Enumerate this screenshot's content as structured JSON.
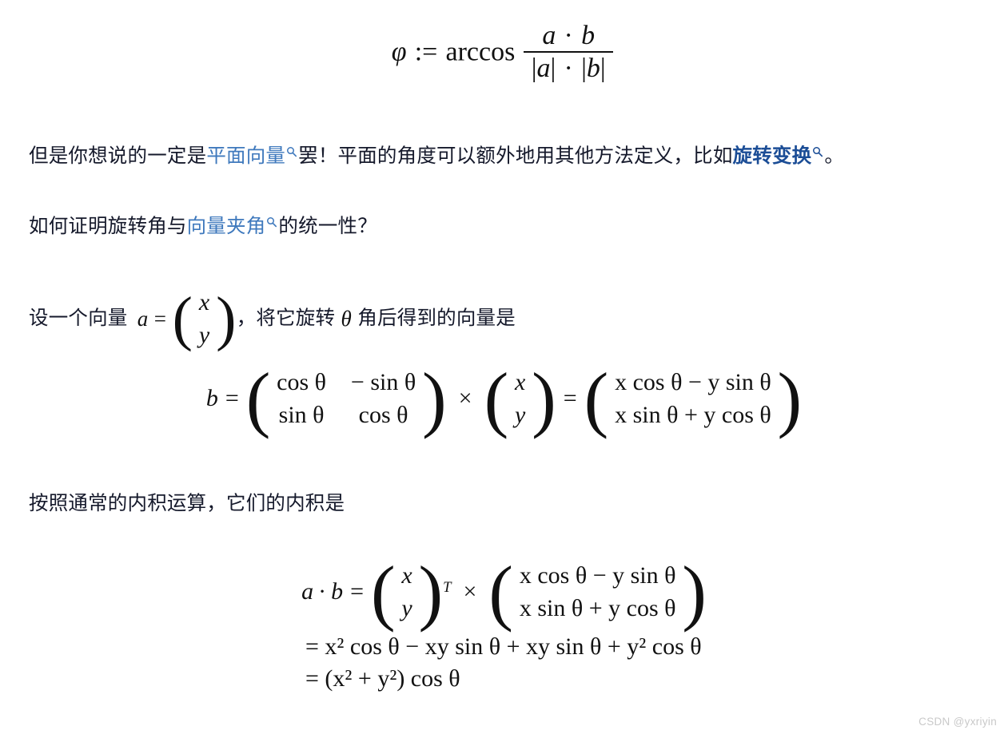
{
  "document": {
    "background": "#ffffff",
    "text_color": "#15192b",
    "math_color": "#111111",
    "link_color": "#3f79bd",
    "link_strong_color": "#1b4d96"
  },
  "formula_1": {
    "name": "angle-definition-formula",
    "phi": "φ",
    "assign": ":=",
    "arccos": "arccos",
    "numerator": {
      "a": "a",
      "dot": "·",
      "b": "b"
    },
    "denominator": {
      "abs_a_open": "|",
      "a": "a",
      "abs_a_close": "|",
      "dot": "·",
      "abs_b_open": "|",
      "b": "b",
      "abs_b_close": "|"
    }
  },
  "paragraph_1": {
    "part_1": "但是你想说的一定是",
    "link_1": "平面向量",
    "part_2": "罢！平面的角度可以额外地用其他方法定义，比如",
    "link_2": "旋转变换",
    "part_3": "。",
    "icon_1": "search-icon",
    "icon_2": "search-icon"
  },
  "paragraph_2": {
    "part_1": "如何证明旋转角与",
    "link_1": "向量夹角",
    "part_2": "的统一性？",
    "icon_1": "search-icon"
  },
  "paragraph_3": {
    "part_1": "设一个向量",
    "math_a": "a",
    "math_eq": "=",
    "vector": {
      "x": "x",
      "y": "y"
    },
    "part_2": "，将它旋转",
    "math_theta": "θ",
    "part_3": "角后得到的向量是"
  },
  "formula_2": {
    "name": "rotation-matrix-equation",
    "b": "b",
    "eq1": "=",
    "matrix": {
      "r1c1": "cos θ",
      "r1c2": "− sin θ",
      "r2c1": "sin θ",
      "r2c2": "cos θ"
    },
    "times": "×",
    "vector": {
      "x": "x",
      "y": "y"
    },
    "eq2": "=",
    "result": {
      "row1": "x cos θ − y sin θ",
      "row2": "x sin θ + y cos θ"
    }
  },
  "paragraph_4": {
    "text": "按照通常的内积运算，它们的内积是"
  },
  "formula_3": {
    "name": "inner-product-derivation",
    "lhs": {
      "a": "a",
      "dot": "·",
      "b": "b",
      "eq": "="
    },
    "vector": {
      "x": "x",
      "y": "y"
    },
    "transpose": "T",
    "times": "×",
    "rotated": {
      "row1": "x cos θ − y sin θ",
      "row2": "x sin θ + y cos θ"
    },
    "line2": "= x² cos θ − xy sin θ + xy sin θ + y² cos θ",
    "line3": "= (x² + y²) cos θ"
  },
  "watermark": {
    "text": "CSDN @yxriyin"
  }
}
